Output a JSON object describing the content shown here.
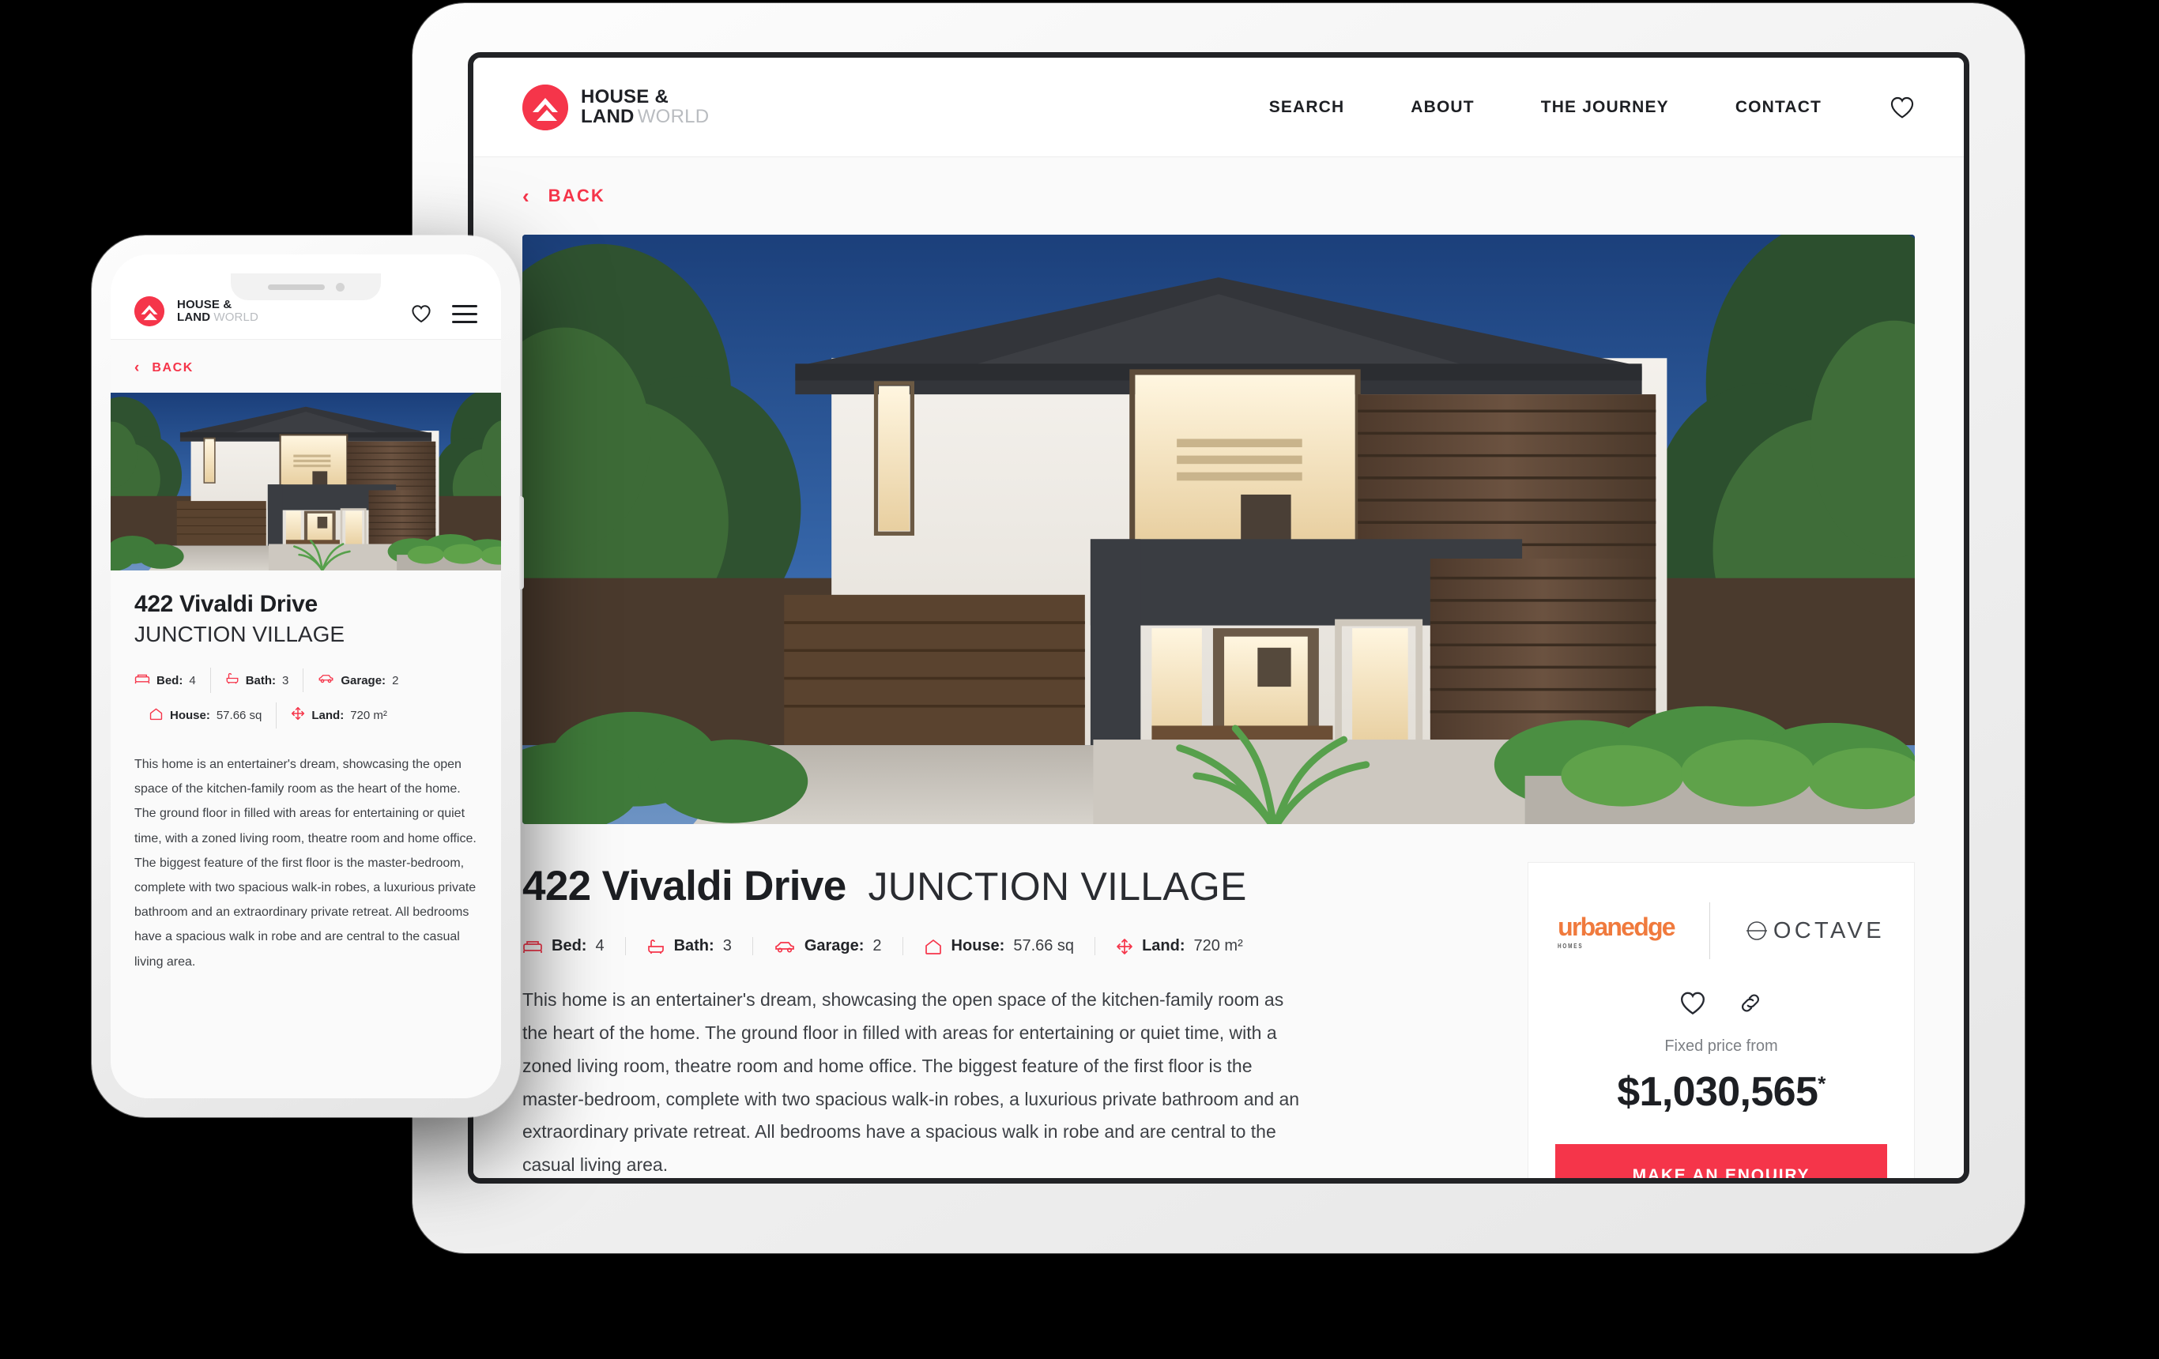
{
  "brand": {
    "line1_bold": "HOUSE &",
    "line2_bold": "LAND",
    "line2_light": "WORLD",
    "accent_color": "#F5354A"
  },
  "tablet": {
    "nav": [
      {
        "label": "SEARCH"
      },
      {
        "label": "ABOUT"
      },
      {
        "label": "THE JOURNEY"
      },
      {
        "label": "CONTACT"
      }
    ],
    "favourite_icon": "heart-icon",
    "back": {
      "chevron": "‹",
      "label": "BACK"
    },
    "hero_image_alt": "two-storey-house-exterior-dusk"
  },
  "phone": {
    "favourite_icon": "heart-icon",
    "menu_icon": "hamburger-menu-icon",
    "back": {
      "chevron": "‹",
      "label": "BACK"
    },
    "hero_image_alt": "two-storey-house-exterior-dusk"
  },
  "property": {
    "address": "422 Vivaldi Drive",
    "suburb": "JUNCTION VILLAGE",
    "specs": [
      {
        "icon": "bed-icon",
        "label": "Bed:",
        "value": "4"
      },
      {
        "icon": "bath-icon",
        "label": "Bath:",
        "value": "3"
      },
      {
        "icon": "car-icon",
        "label": "Garage:",
        "value": "2"
      },
      {
        "icon": "house-icon",
        "label": "House:",
        "value": "57.66 sq"
      },
      {
        "icon": "arrows-icon",
        "label": "Land:",
        "value": "720 m²"
      }
    ],
    "description": "This home is an entertainer's dream, showcasing the open space of the kitchen-family room as the heart of the home. The ground floor in filled with areas for entertaining or quiet time, with a zoned living room, theatre room and home office. The biggest feature of the first floor is the master-bedroom, complete with two spacious walk-in robes, a luxurious private bathroom and an extraordinary private retreat. All bedrooms have a spacious walk in robe and are central to the casual living area."
  },
  "price_card": {
    "builder_logo": {
      "name": "urbanedge",
      "sub": "HOMES",
      "color": "#F07A3D"
    },
    "range_logo": {
      "name": "OCTAVE"
    },
    "favourite_icon": "heart-icon",
    "share_icon": "link-icon",
    "price_label": "Fixed price from",
    "price": "$1,030,565",
    "price_asterisk": "*",
    "cta_label": "MAKE AN ENQUIRY",
    "cta_color": "#F5354A"
  }
}
